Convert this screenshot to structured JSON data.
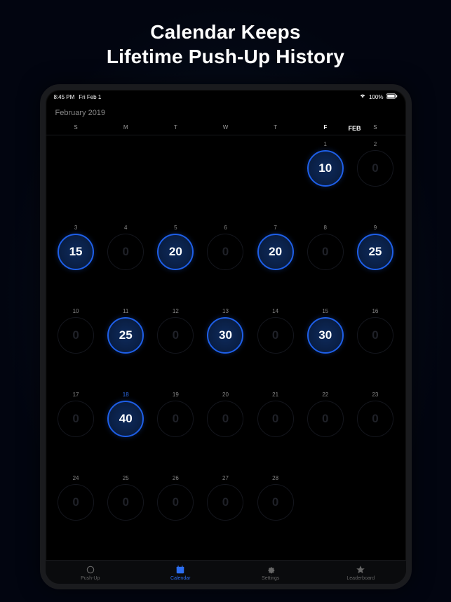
{
  "headline_line1": "Calendar Keeps",
  "headline_line2": "Lifetime Push-Up History",
  "status": {
    "time": "8:45 PM",
    "date": "Fri Feb 1",
    "battery": "100%"
  },
  "month_title": "February 2019",
  "month_badge": "FEB",
  "weekdays": [
    "S",
    "M",
    "T",
    "W",
    "T",
    "F",
    "S"
  ],
  "weekday_highlight": 5,
  "cells": [
    {
      "day": "",
      "val": null
    },
    {
      "day": "",
      "val": null
    },
    {
      "day": "",
      "val": null
    },
    {
      "day": "",
      "val": null
    },
    {
      "day": "",
      "val": null
    },
    {
      "day": "1",
      "val": 10,
      "filled": true
    },
    {
      "day": "2",
      "val": 0
    },
    {
      "day": "3",
      "val": 15,
      "filled": true
    },
    {
      "day": "4",
      "val": 0
    },
    {
      "day": "5",
      "val": 20,
      "filled": true
    },
    {
      "day": "6",
      "val": 0
    },
    {
      "day": "7",
      "val": 20,
      "filled": true
    },
    {
      "day": "8",
      "val": 0
    },
    {
      "day": "9",
      "val": 25,
      "filled": true
    },
    {
      "day": "10",
      "val": 0
    },
    {
      "day": "11",
      "val": 25,
      "filled": true
    },
    {
      "day": "12",
      "val": 0
    },
    {
      "day": "13",
      "val": 30,
      "filled": true
    },
    {
      "day": "14",
      "val": 0
    },
    {
      "day": "15",
      "val": 30,
      "filled": true
    },
    {
      "day": "16",
      "val": 0
    },
    {
      "day": "17",
      "val": 0
    },
    {
      "day": "18",
      "val": 40,
      "filled": true,
      "today": true
    },
    {
      "day": "19",
      "val": 0
    },
    {
      "day": "20",
      "val": 0
    },
    {
      "day": "21",
      "val": 0
    },
    {
      "day": "22",
      "val": 0
    },
    {
      "day": "23",
      "val": 0
    },
    {
      "day": "24",
      "val": 0
    },
    {
      "day": "25",
      "val": 0
    },
    {
      "day": "26",
      "val": 0
    },
    {
      "day": "27",
      "val": 0
    },
    {
      "day": "28",
      "val": 0
    },
    {
      "day": "",
      "val": null
    },
    {
      "day": "",
      "val": null
    }
  ],
  "tabs": [
    {
      "label": "Push-Up",
      "icon": "circle"
    },
    {
      "label": "Calendar",
      "icon": "calendar",
      "active": true
    },
    {
      "label": "Settings",
      "icon": "gear"
    },
    {
      "label": "Leaderboard",
      "icon": "star"
    }
  ]
}
